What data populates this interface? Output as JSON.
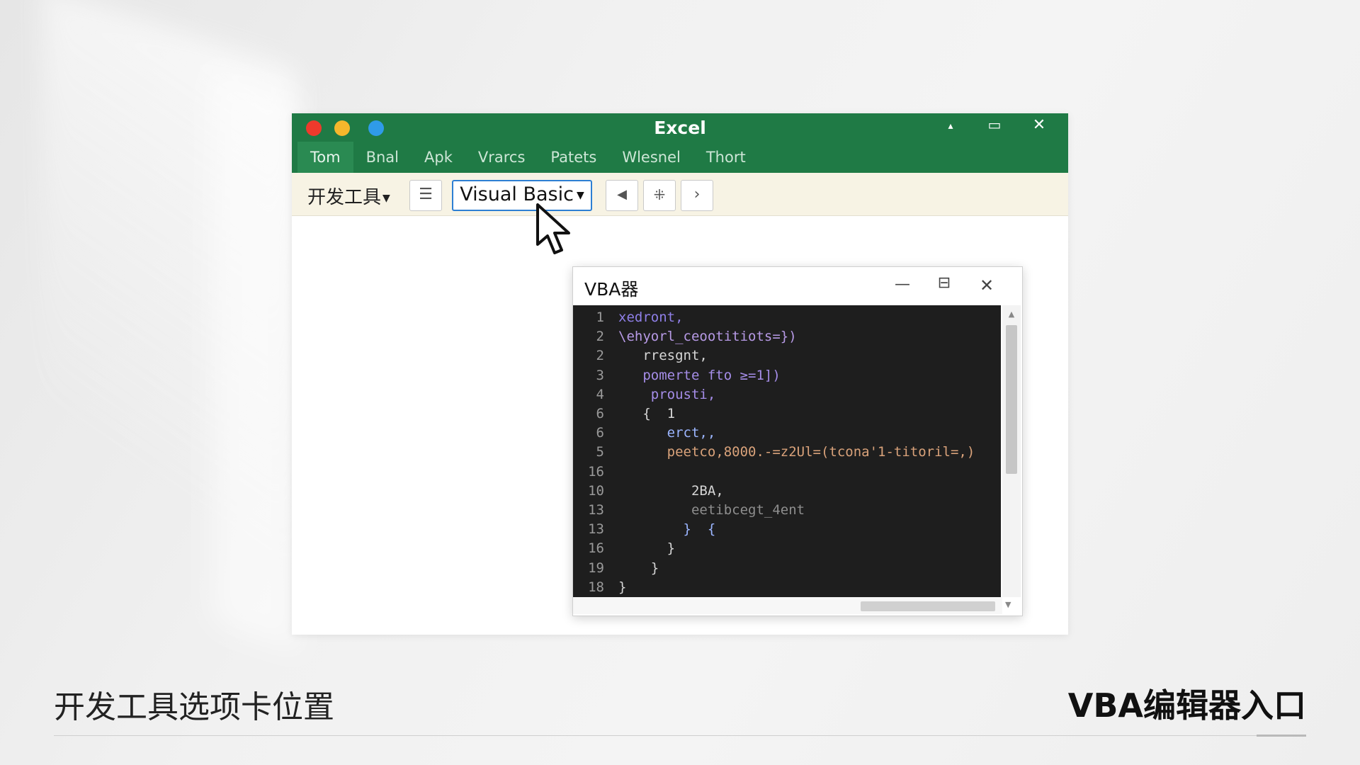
{
  "window": {
    "title": "Excel",
    "controls": {
      "collapse": "▴",
      "maximize": "▭",
      "close": "✕"
    }
  },
  "menu": {
    "items": [
      "Tom",
      "Bnal",
      "Apk",
      "Vrarcs",
      "Patets",
      "Wlesnel",
      "Thort"
    ],
    "active_index": 0
  },
  "ribbon": {
    "developer_tab": "开发工具",
    "visual_basic_button": "Visual Basic"
  },
  "vba_window": {
    "title": "VBA器",
    "controls": {
      "minimize": "—",
      "maximize": "⊟",
      "close": "✕"
    },
    "code_lines": [
      {
        "num": "1",
        "indent": 0,
        "text": "xedront,",
        "color": "#8f7fe8"
      },
      {
        "num": "2",
        "indent": 0,
        "text": "\\ehyorl_ceootitiots=})",
        "color": "#b79ae6"
      },
      {
        "num": "2",
        "indent": 3,
        "text": "rresgnt,",
        "color": "#d6d6d6"
      },
      {
        "num": "3",
        "indent": 3,
        "text": "pomerte fto ≥=1])",
        "color": "#a58de8"
      },
      {
        "num": "4",
        "indent": 3,
        "text": " prousti,",
        "color": "#a58de8"
      },
      {
        "num": "6",
        "indent": 3,
        "text": "{  1",
        "color": "#d6d6d6"
      },
      {
        "num": "6",
        "indent": 6,
        "text": "erct,,",
        "color": "#9bb5ff"
      },
      {
        "num": "5",
        "indent": 6,
        "text": "peetco,8000.-=z2Ul=(tcona'1-titoril=,)",
        "color": "#d9a27a"
      },
      {
        "num": "16",
        "indent": 0,
        "text": "",
        "color": "#d6d6d6"
      },
      {
        "num": "10",
        "indent": 9,
        "text": "2BA,",
        "color": "#d6d6d6"
      },
      {
        "num": "13",
        "indent": 9,
        "text": "eetibcegt_4ent",
        "color": "#8e8e8e"
      },
      {
        "num": "13",
        "indent": 8,
        "text": "}  {",
        "color": "#9bb5ff"
      },
      {
        "num": "16",
        "indent": 6,
        "text": "}",
        "color": "#d6d6d6"
      },
      {
        "num": "19",
        "indent": 4,
        "text": "}",
        "color": "#d6d6d6"
      },
      {
        "num": "18",
        "indent": 0,
        "text": "}",
        "color": "#d6d6d6"
      }
    ]
  },
  "captions": {
    "left": "开发工具选项卡位置",
    "right": "VBA编辑器入口"
  },
  "colors": {
    "excel_green": "#1f7a45",
    "ribbon_bg": "#f7f3e4",
    "code_bg": "#1e1e1e",
    "accent_blue": "#2d7fd3"
  }
}
